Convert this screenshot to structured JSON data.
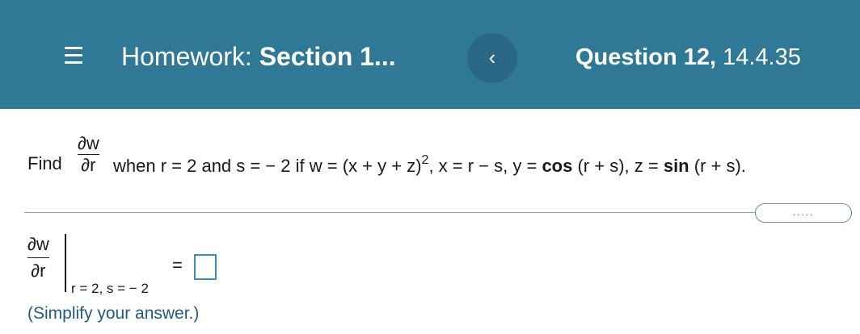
{
  "header": {
    "title_prefix": "Homework:",
    "title_section": "Section 1...",
    "back_glyph": "‹",
    "question_label": "Question 12,",
    "question_ref": "14.4.35"
  },
  "problem": {
    "find": "Find",
    "numerator": "∂w",
    "denominator": "∂r",
    "text_before_exp": "when r = 2 and s = − 2 if w = (x + y + z)",
    "exponent": "2",
    "text_after_exp": ", x = r − s, y = ",
    "cos": "cos",
    "text_mid": " (r + s), z = ",
    "sin": "sin",
    "text_end": " (r + s)."
  },
  "more_button": {
    "label": "....."
  },
  "answer": {
    "numerator": "∂w",
    "denominator": "∂r",
    "subscript": "r = 2, s = − 2",
    "equals": "=",
    "value": "",
    "hint": "(Simplify your answer.)"
  },
  "colors": {
    "header_bg": "#2f7896",
    "back_btn_bg": "#2a6785",
    "hint_text": "#1f5a85",
    "answer_box_border": "#3a8fc0"
  },
  "icons": {
    "menu": "hamburger-menu-icon",
    "back": "chevron-left-icon"
  }
}
